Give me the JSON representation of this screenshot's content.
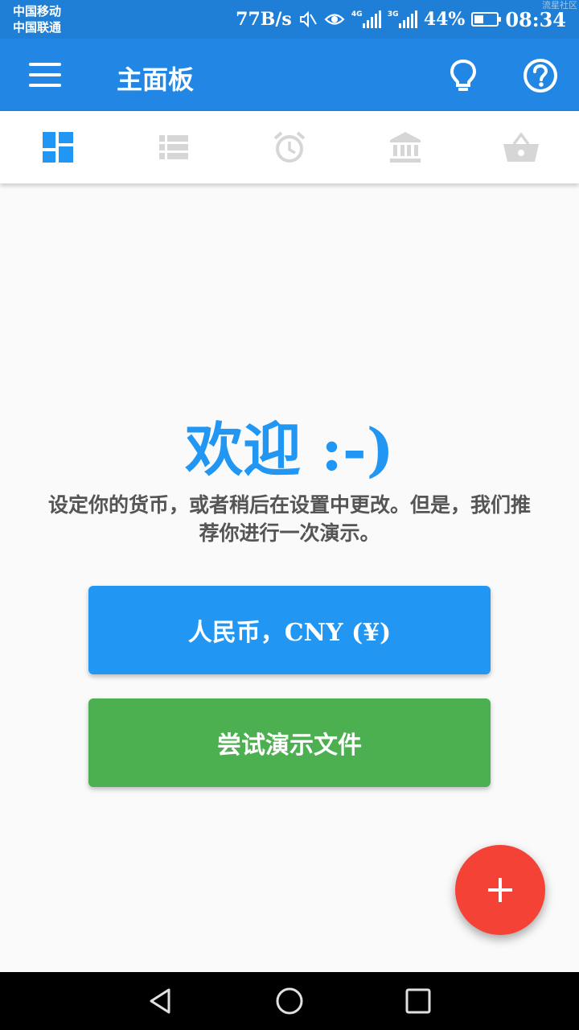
{
  "status_bar": {
    "carrier1": "中国移动",
    "carrier2": "中国联通",
    "speed": "77B/s",
    "sig1_label": "4G",
    "sig2_label": "3G",
    "battery": "44%",
    "battery_level": 0.44,
    "time": "08:34",
    "watermark": "流星社区"
  },
  "app_bar": {
    "title": "主面板",
    "icons": [
      "menu-icon",
      "lightbulb-icon",
      "help-icon"
    ],
    "color": "#2186e4"
  },
  "tabs": [
    {
      "name": "dashboard",
      "icon": "dashboard-icon",
      "active": true
    },
    {
      "name": "list",
      "icon": "list-icon",
      "active": false
    },
    {
      "name": "alarm",
      "icon": "alarm-clock-icon",
      "active": false
    },
    {
      "name": "bank",
      "icon": "bank-icon",
      "active": false
    },
    {
      "name": "basket",
      "icon": "basket-icon",
      "active": false
    }
  ],
  "main": {
    "welcome": "欢迎 :-)",
    "description": "设定你的货币，或者稍后在设置中更改。但是，我们推荐你进行一次演示。",
    "currency_button": "人民币，CNY (¥)",
    "demo_button": "尝试演示文件"
  },
  "fab": {
    "icon": "plus-icon",
    "color": "#f44336"
  },
  "nav_bar": {
    "icons": [
      "back-icon",
      "home-icon",
      "recents-icon"
    ]
  },
  "colors": {
    "primary": "#2196f3",
    "success": "#4caf50",
    "accent": "#f44336",
    "tab_inactive": "#d6d6d6"
  }
}
